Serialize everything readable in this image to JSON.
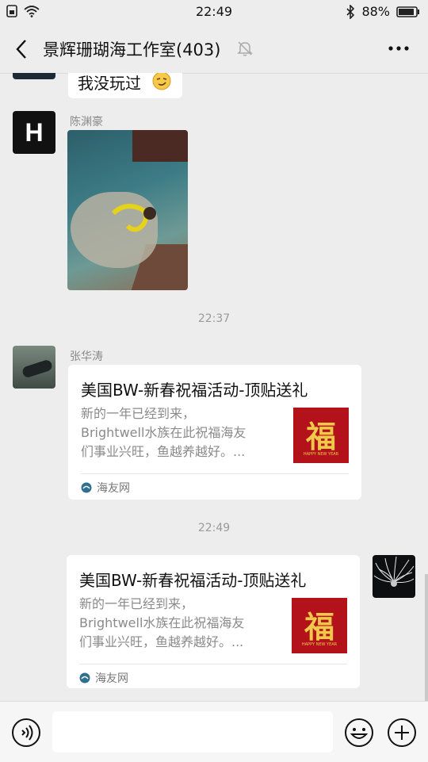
{
  "status": {
    "time": "22:49",
    "battery": "88%"
  },
  "header": {
    "title": "景辉珊瑚海工作室(403)"
  },
  "messages": {
    "m0": {
      "text": "我没玩过"
    },
    "m1": {
      "sender": "陈渊豪",
      "avatar_letter": "H"
    },
    "ts1": "22:37",
    "m2": {
      "sender": "张华涛",
      "card_title": "美国BW-新春祝福活动-顶贴送礼",
      "card_desc": "新的一年已经到来，\nBrightwell水族在此祝福海友\n们事业兴旺，鱼越养越好。...",
      "thumb_char": "福",
      "thumb_caption": "HAPPY NEW YEAR",
      "source": "海友网"
    },
    "ts2": "22:49",
    "m3": {
      "card_title": "美国BW-新春祝福活动-顶贴送礼",
      "card_desc": "新的一年已经到来，\nBrightwell水族在此祝福海友\n们事业兴旺，鱼越养越好。...",
      "thumb_char": "福",
      "thumb_caption": "HAPPY NEW YEAR",
      "source": "海友网"
    }
  },
  "input": {
    "value": ""
  }
}
